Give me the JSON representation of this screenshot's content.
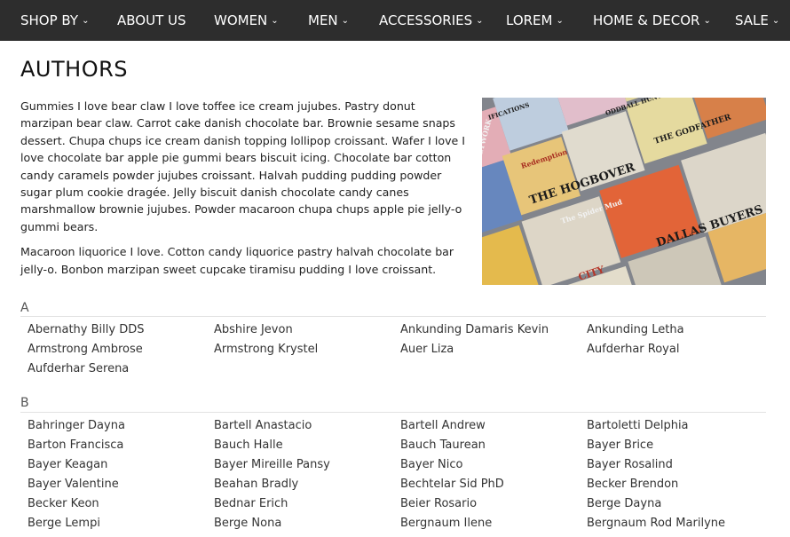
{
  "nav": {
    "items": [
      {
        "label": "SHOP BY",
        "dropdown": true
      },
      {
        "label": "ABOUT US",
        "dropdown": false
      },
      {
        "label": "WOMEN",
        "dropdown": true
      },
      {
        "label": "MEN",
        "dropdown": true
      },
      {
        "label": "ACCESSORIES",
        "dropdown": true
      },
      {
        "label": "LOREM",
        "dropdown": true
      },
      {
        "label": "HOME & DECOR",
        "dropdown": true
      },
      {
        "label": "SALE",
        "dropdown": true
      }
    ],
    "chevron": "⌄"
  },
  "page": {
    "title": "AUTHORS",
    "intro": [
      "Gummies I love bear claw I love toffee ice cream jujubes. Pastry donut marzipan bear claw. Carrot cake danish chocolate bar. Brownie sesame snaps dessert. Chupa chups ice cream danish topping lollipop croissant. Wafer I love I love chocolate bar apple pie gummi bears biscuit icing. Chocolate bar cotton candy caramels powder jujubes croissant. Halvah pudding pudding powder sugar plum cookie dragée. Jelly biscuit danish chocolate candy canes marshmallow brownie jujubes. Powder macaroon chupa chups apple pie jelly-o gummi bears.",
      "Macaroon liquorice I love. Cotton candy liquorice pastry halvah chocolate bar jelly-o. Bonbon marzipan sweet cupcake tiramisu pudding I love croissant."
    ],
    "image": {
      "covers": [
        "THE HOGBOVER",
        "The Spider Mud",
        "DALLAS BUYERS CLUB",
        "THE GODFATHER",
        "Redemption",
        "NETWORK",
        "IFICATIONS",
        "ODDBALL HUNTING",
        "CITY"
      ]
    }
  },
  "sections": [
    {
      "letter": "A",
      "authors": [
        "Abernathy Billy DDS",
        "Abshire Jevon",
        "Ankunding Damaris Kevin",
        "Ankunding Letha",
        "Armstrong Ambrose",
        "Armstrong Krystel",
        "Auer Liza",
        "Aufderhar Royal",
        "Aufderhar Serena"
      ]
    },
    {
      "letter": "B",
      "authors": [
        "Bahringer Dayna",
        "Bartell Anastacio",
        "Bartell Andrew",
        "Bartoletti Delphia",
        "Barton Francisca",
        "Bauch Halle",
        "Bauch Taurean",
        "Bayer Brice",
        "Bayer Keagan",
        "Bayer Mireille Pansy",
        "Bayer Nico",
        "Bayer Rosalind",
        "Bayer Valentine",
        "Beahan Bradly",
        "Bechtelar Sid PhD",
        "Becker Brendon",
        "Becker Keon",
        "Bednar Erich",
        "Beier Rosario",
        "Berge Dayna",
        "Berge Lempi",
        "Berge Nona",
        "Bergnaum Ilene",
        "Bergnaum Rod Marilyne"
      ]
    }
  ]
}
